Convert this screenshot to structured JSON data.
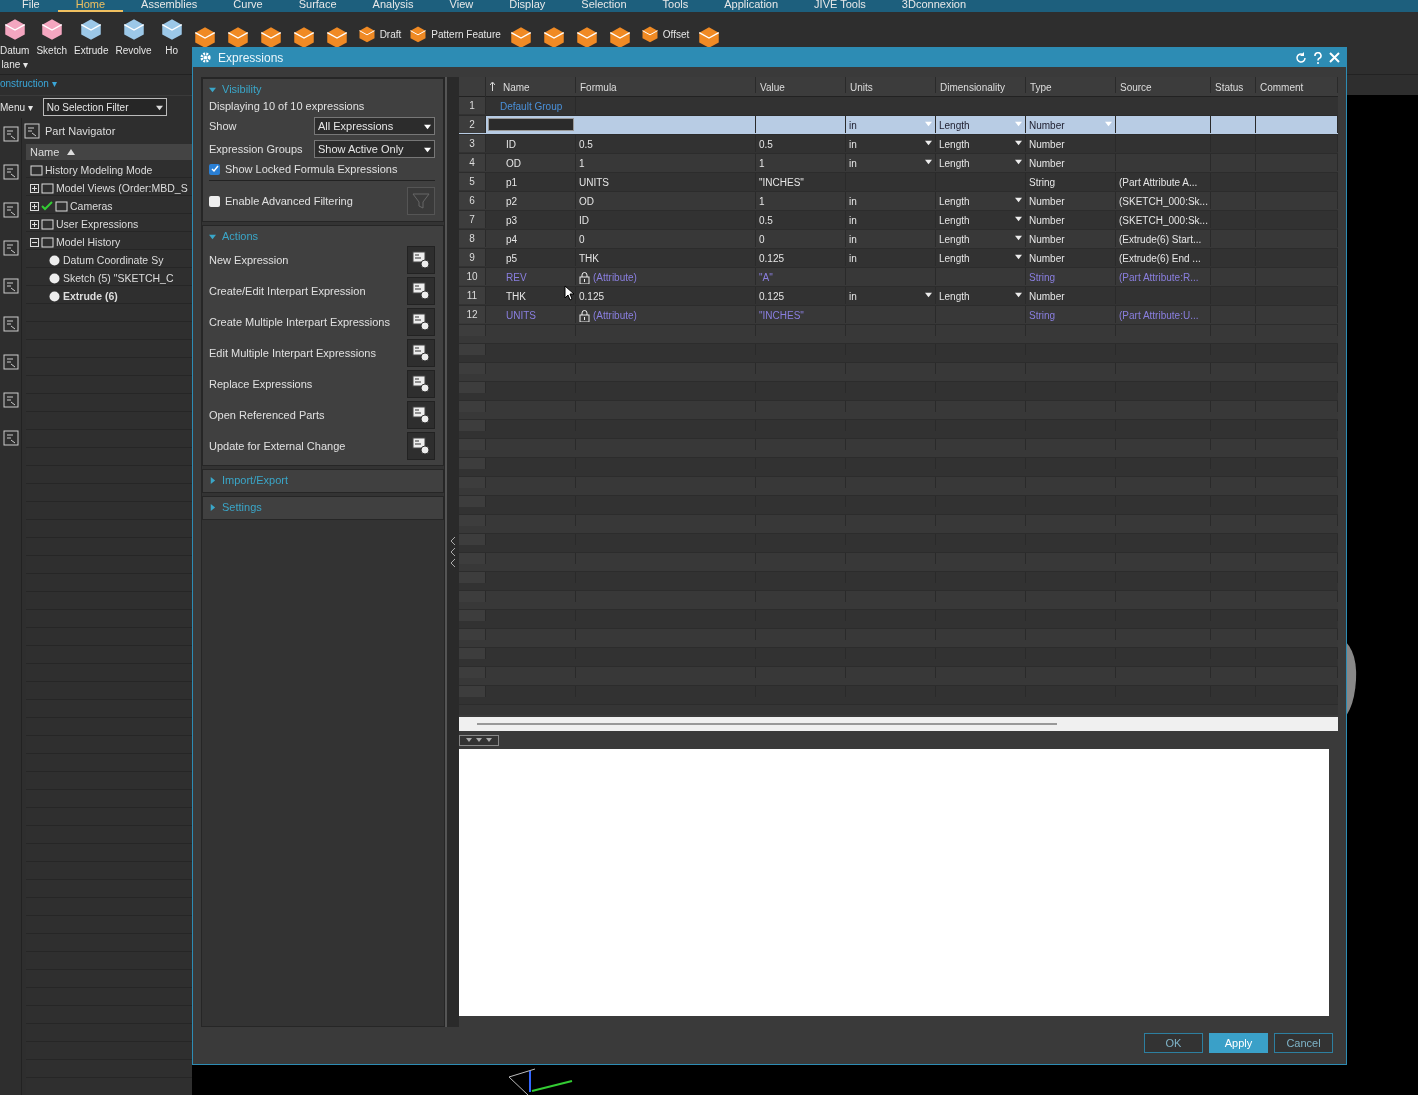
{
  "ribbon_tabs": [
    {
      "label": "File",
      "selected": false
    },
    {
      "label": "Home",
      "selected": true
    },
    {
      "label": "Assemblies",
      "selected": false
    },
    {
      "label": "Curve",
      "selected": false
    },
    {
      "label": "Surface",
      "selected": false
    },
    {
      "label": "Analysis",
      "selected": false
    },
    {
      "label": "View",
      "selected": false
    },
    {
      "label": "Display",
      "selected": false
    },
    {
      "label": "Selection",
      "selected": false
    },
    {
      "label": "Tools",
      "selected": false
    },
    {
      "label": "Application",
      "selected": false
    },
    {
      "label": "JIVE Tools",
      "selected": false
    },
    {
      "label": "3Dconnexion",
      "selected": false
    }
  ],
  "toolbar": [
    {
      "kind": "large",
      "lines": [
        "Datum",
        "lane ▾"
      ]
    },
    {
      "kind": "large",
      "lines": [
        "Sketch"
      ]
    },
    {
      "kind": "large",
      "lines": [
        "Extrude"
      ]
    },
    {
      "kind": "large",
      "lines": [
        "Revolve"
      ]
    },
    {
      "kind": "large",
      "lines": [
        "Ho"
      ]
    },
    {
      "kind": "icon"
    },
    {
      "kind": "icon"
    },
    {
      "kind": "icon"
    },
    {
      "kind": "icon"
    },
    {
      "kind": "icon"
    },
    {
      "kind": "small",
      "lines": [
        "Draft"
      ]
    },
    {
      "kind": "small",
      "lines": [
        "Pattern Feature"
      ]
    },
    {
      "kind": "icon"
    },
    {
      "kind": "icon"
    },
    {
      "kind": "icon"
    },
    {
      "kind": "icon"
    },
    {
      "kind": "small",
      "lines": [
        "Offset"
      ]
    },
    {
      "kind": "icon"
    }
  ],
  "left": {
    "construction": "onstruction ▾",
    "menu": "Menu ▾",
    "selection_filter": "No Selection Filter",
    "navigator_title": "Part Navigator",
    "column": "Name",
    "tree": [
      {
        "label": "History Modeling Mode"
      },
      {
        "label": "Model Views (Order:MBD_S",
        "expanded": false
      },
      {
        "label": "Cameras",
        "expanded": false,
        "checked": true
      },
      {
        "label": "User Expressions",
        "expanded": false
      },
      {
        "label": "Model History",
        "expanded": true,
        "children": [
          {
            "label": "Datum Coordinate Sy"
          },
          {
            "label": "Sketch (5) \"SKETCH_C"
          },
          {
            "label": "Extrude (6)",
            "current": true
          }
        ]
      }
    ]
  },
  "dialog": {
    "title": "Expressions",
    "visibility": {
      "title": "Visibility",
      "expanded": true,
      "summary": "Displaying 10 of 10 expressions",
      "show_label": "Show",
      "show_value": "All Expressions",
      "groups_label": "Expression Groups",
      "groups_value": "Show Active Only",
      "show_locked": {
        "label": "Show Locked Formula Expressions",
        "checked": true
      },
      "advanced": {
        "label": "Enable Advanced Filtering",
        "checked": false
      }
    },
    "actions": {
      "title": "Actions",
      "expanded": true,
      "items": [
        "New Expression",
        "Create/Edit Interpart Expression",
        "Create Multiple Interpart Expressions",
        "Edit Multiple Interpart Expressions",
        "Replace Expressions",
        "Open Referenced Parts",
        "Update for External Change"
      ]
    },
    "collapsed_sections": [
      {
        "title": "Import/Export",
        "expanded": false
      },
      {
        "title": "Settings",
        "expanded": false
      }
    ],
    "table": {
      "columns": [
        "Name",
        "Formula",
        "Value",
        "Units",
        "Dimensionality",
        "Type",
        "Source",
        "Status",
        "Comment"
      ],
      "rows": [
        {
          "number": "1",
          "kind": "group",
          "name": "Default Group",
          "selected": false
        },
        {
          "number": "2",
          "kind": "new",
          "units": "in",
          "dimensionality": "Length",
          "type": "Number",
          "selected": true
        },
        {
          "number": "3",
          "kind": "expression",
          "name": "ID",
          "formula": "0.5",
          "value": "0.5",
          "units": "in",
          "units_dropdown": true,
          "dimensionality": "Length",
          "dimensionality_dropdown": true,
          "type": "Number",
          "selected": false
        },
        {
          "number": "4",
          "kind": "expression",
          "name": "OD",
          "formula": "1",
          "value": "1",
          "units": "in",
          "units_dropdown": true,
          "dimensionality": "Length",
          "dimensionality_dropdown": true,
          "type": "Number",
          "selected": false
        },
        {
          "number": "5",
          "kind": "expression",
          "name": "p1",
          "formula": "UNITS",
          "value": "\"INCHES\"",
          "type": "String",
          "source": "(Part Attribute A...",
          "selected": false
        },
        {
          "number": "6",
          "kind": "expression",
          "name": "p2",
          "formula": "OD",
          "value": "1",
          "units": "in",
          "dimensionality": "Length",
          "dimensionality_dropdown": true,
          "type": "Number",
          "source": "(SKETCH_000:Sk...",
          "selected": false
        },
        {
          "number": "7",
          "kind": "expression",
          "name": "p3",
          "formula": "ID",
          "value": "0.5",
          "units": "in",
          "dimensionality": "Length",
          "dimensionality_dropdown": true,
          "type": "Number",
          "source": "(SKETCH_000:Sk...",
          "selected": false
        },
        {
          "number": "8",
          "kind": "expression",
          "name": "p4",
          "formula": "0",
          "value": "0",
          "units": "in",
          "dimensionality": "Length",
          "dimensionality_dropdown": true,
          "type": "Number",
          "source": "(Extrude(6) Start...",
          "selected": false
        },
        {
          "number": "9",
          "kind": "expression",
          "name": "p5",
          "formula": "THK",
          "value": "0.125",
          "units": "in",
          "dimensionality": "Length",
          "dimensionality_dropdown": true,
          "type": "Number",
          "source": "(Extrude(6) End ...",
          "selected": false
        },
        {
          "number": "10",
          "kind": "attribute",
          "name": "REV",
          "formula": "(Attribute)",
          "locked": true,
          "value": "\"A\"",
          "type": "String",
          "source": "(Part Attribute:R...",
          "selected": false
        },
        {
          "number": "11",
          "kind": "expression",
          "name": "THK",
          "formula": "0.125",
          "value": "0.125",
          "units": "in",
          "units_dropdown": true,
          "dimensionality": "Length",
          "dimensionality_dropdown": true,
          "type": "Number",
          "selected": false
        },
        {
          "number": "12",
          "kind": "attribute",
          "name": "UNITS",
          "formula": "(Attribute)",
          "locked": true,
          "value": "\"INCHES\"",
          "type": "String",
          "source": "(Part Attribute:U...",
          "selected": false
        }
      ]
    },
    "buttons": [
      {
        "label": "OK",
        "default": false
      },
      {
        "label": "Apply",
        "default": true
      },
      {
        "label": "Cancel",
        "default": false
      }
    ]
  }
}
